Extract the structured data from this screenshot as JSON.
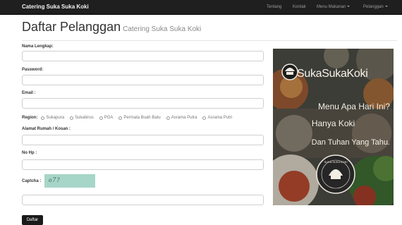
{
  "navbar": {
    "brand": "Catering Suka Suka Koki",
    "items": [
      {
        "label": "Tentang",
        "dropdown": false
      },
      {
        "label": "Kontak",
        "dropdown": false
      },
      {
        "label": "Menu Makanan",
        "dropdown": true
      },
      {
        "label": "Pelanggan",
        "dropdown": true
      }
    ]
  },
  "page": {
    "title": "Daftar Pelanggan",
    "subtitle": "Catering Suka Suka Koki"
  },
  "form": {
    "name_label": "Nama Lengkap:",
    "name_value": "",
    "password_label": "Password:",
    "password_value": "",
    "email_label": "Email :",
    "email_value": "",
    "region_label": "Region:",
    "region_options": [
      "Sukapura",
      "Sukabirus",
      "PGA",
      "Permata Buah Batu",
      "Asrama Putra",
      "Asrama Putri"
    ],
    "address_label": "Alamat Rumah / Kosan :",
    "address_value": "",
    "phone_label": "No Hp :",
    "phone_value": "",
    "captcha_label": "Captcha :",
    "captcha_text": "o7?",
    "captcha_value": "",
    "submit_label": "Daftar"
  },
  "promo": {
    "brand": "SukaSukaKoki",
    "line1": "Menu Apa Hari Ini?",
    "line2": "Hanya Koki",
    "line3": "Dan Tuhan Yang Tahu.",
    "round_logo_text": "SUKA SUKA KOKI"
  },
  "colors": {
    "navbar_bg": "#1f1f1f",
    "button_bg": "#1a1a1a",
    "captcha_bg": "#a6d6c8"
  }
}
